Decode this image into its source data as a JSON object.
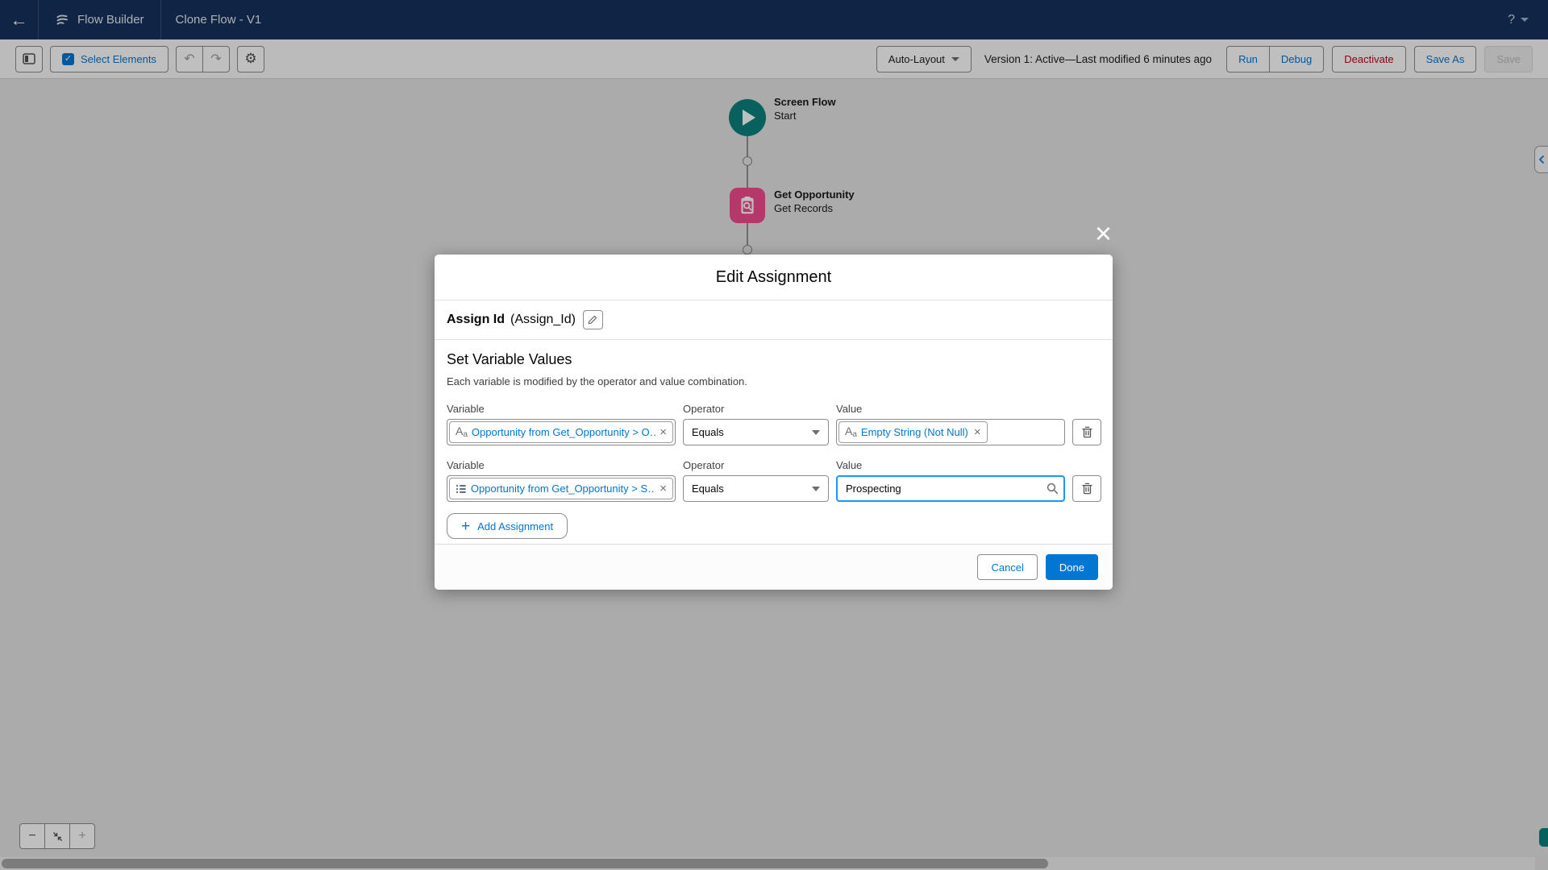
{
  "header": {
    "app_label": "Flow Builder",
    "flow_title": "Clone Flow - V1",
    "help_label": "?"
  },
  "toolbar": {
    "select_elements_label": "Select Elements",
    "layout_selector": "Auto-Layout",
    "version_status": "Version 1: Active—Last modified 6 minutes ago",
    "run_label": "Run",
    "debug_label": "Debug",
    "deactivate_label": "Deactivate",
    "save_as_label": "Save As",
    "save_label": "Save"
  },
  "canvas": {
    "start_node": {
      "title": "Screen Flow",
      "subtitle": "Start"
    },
    "get_node": {
      "title": "Get Opportunity",
      "subtitle": "Get Records"
    }
  },
  "modal": {
    "title": "Edit Assignment",
    "assignment_name": "Assign Id",
    "assignment_api_name": "(Assign_Id)",
    "section_heading": "Set Variable Values",
    "section_description": "Each variable is modified by the operator and value combination.",
    "rows": [
      {
        "variable_label": "Variable",
        "variable_pill": "Opportunity from Get_Opportunity > O…",
        "operator_label": "Operator",
        "operator_value": "Equals",
        "value_label": "Value",
        "value_pill": "Empty String (Not Null)"
      },
      {
        "variable_label": "Variable",
        "variable_pill": "Opportunity from Get_Opportunity > S…",
        "operator_label": "Operator",
        "operator_value": "Equals",
        "value_label": "Value",
        "value_input": "Prospecting"
      }
    ],
    "add_assignment_label": "Add Assignment",
    "cancel_label": "Cancel",
    "done_label": "Done"
  },
  "icons": {
    "back": "←",
    "undo": "↶",
    "redo": "↷",
    "gear": "⚙",
    "check": "✓",
    "close": "×",
    "remove": "×",
    "minus": "−",
    "plus": "+",
    "add_plus": "+",
    "text_type_A": "A",
    "text_type_a": "a"
  },
  "colors": {
    "brand_navy": "#16325c",
    "accent_blue": "#0176d3",
    "destructive_red": "#ba0517",
    "start_node_teal": "#0b827c",
    "get_node_pink": "#f24b8f",
    "focus_border_blue": "#1b96ff"
  }
}
